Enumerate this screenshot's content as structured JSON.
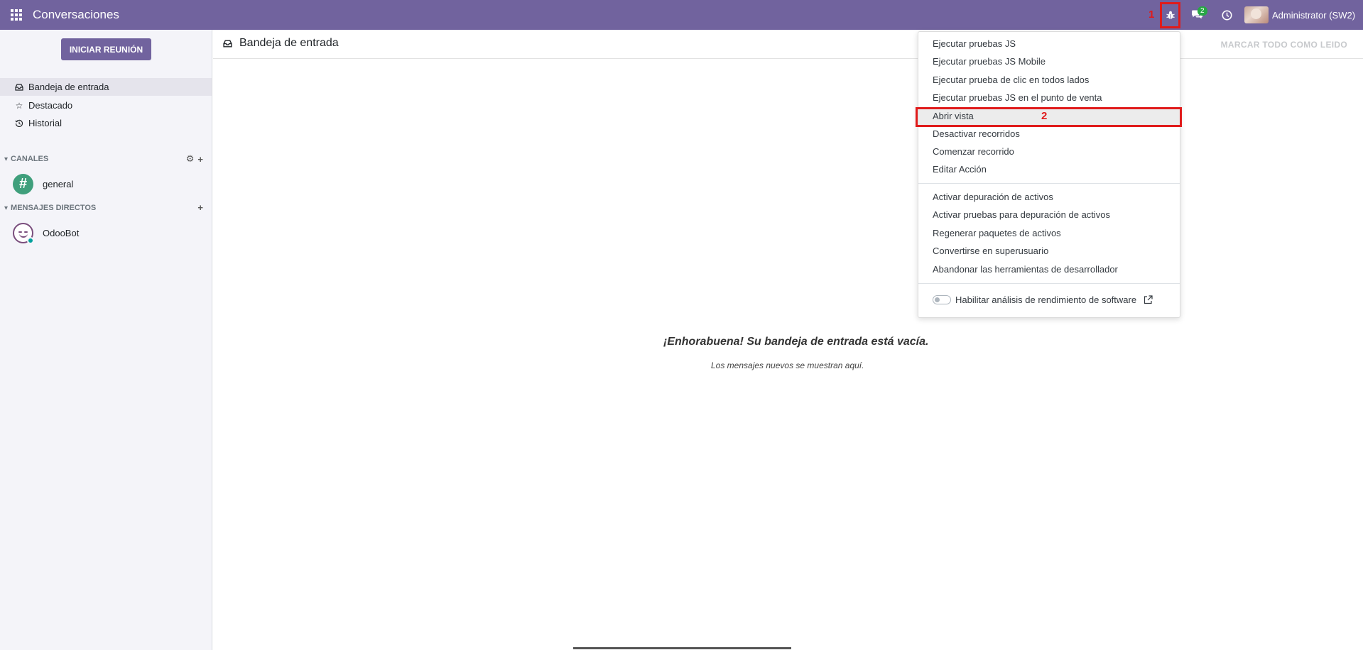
{
  "navbar": {
    "app_title": "Conversaciones",
    "annotation_1": "1",
    "chat_badge": "2",
    "user_name": "Administrator (SW2)"
  },
  "sidebar": {
    "start_meeting_label": "INICIAR REUNIÓN",
    "mailboxes": [
      {
        "label": "Bandeja de entrada",
        "icon": "inbox-icon",
        "active": true
      },
      {
        "label": "Destacado",
        "icon": "star-icon",
        "active": false
      },
      {
        "label": "Historial",
        "icon": "history-icon",
        "active": false
      }
    ],
    "channels_heading": "CANALES",
    "channels": [
      {
        "label": "general",
        "icon": "hash-icon"
      }
    ],
    "direct_heading": "MENSAJES DIRECTOS",
    "direct_messages": [
      {
        "label": "OdooBot",
        "icon": "odoobot-avatar"
      }
    ]
  },
  "main": {
    "title": "Bandeja de entrada",
    "mark_all_label": "MARCAR TODO COMO LEIDO",
    "empty_title": "¡Enhorabuena! Su bandeja de entrada está vacía.",
    "empty_subtitle": "Los mensajes nuevos se muestran aquí."
  },
  "debug_menu": {
    "group1": [
      "Ejecutar pruebas JS",
      "Ejecutar pruebas JS Mobile",
      "Ejecutar prueba de clic en todos lados",
      "Ejecutar pruebas JS en el punto de venta",
      "Abrir vista",
      "Desactivar recorridos",
      "Comenzar recorrido",
      "Editar Acción"
    ],
    "group2": [
      "Activar depuración de activos",
      "Activar pruebas para depuración de activos",
      "Regenerar paquetes de activos",
      "Convertirse en superusuario",
      "Abandonar las herramientas de desarrollador"
    ],
    "perf_label": "Habilitar análisis de rendimiento de software",
    "highlighted_item": "Abrir vista",
    "annotation_2": "2"
  },
  "colors": {
    "brand": "#71639e",
    "annotation": "#e01b1b",
    "badge": "#28a745"
  }
}
